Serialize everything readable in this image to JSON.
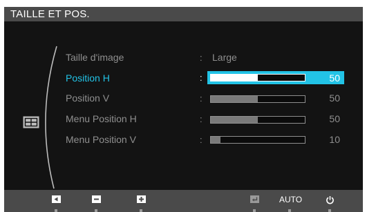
{
  "title": "TAILLE ET POS.",
  "category_icon": "size-position-icon",
  "items": [
    {
      "label": "Taille d'image",
      "value_text": "Large",
      "selected": false
    },
    {
      "label": "Position H",
      "value": 50,
      "value_text": "50",
      "selected": true
    },
    {
      "label": "Position V",
      "value": 50,
      "value_text": "50",
      "selected": false
    },
    {
      "label": "Menu Position H",
      "value": 50,
      "value_text": "50",
      "selected": false
    },
    {
      "label": "Menu Position V",
      "value": 10,
      "value_text": "10",
      "selected": false
    }
  ],
  "colon": ":",
  "bottom_bar": {
    "buttons": [
      "left-arrow-icon",
      "minus-icon",
      "plus-icon",
      "enter-icon"
    ],
    "auto_label": "AUTO",
    "power_icon": "power-icon"
  },
  "colors": {
    "accent": "#22c3e6",
    "background": "#131313",
    "title_bar": "#4a4a4a",
    "text_dim": "#8f8f8f"
  }
}
